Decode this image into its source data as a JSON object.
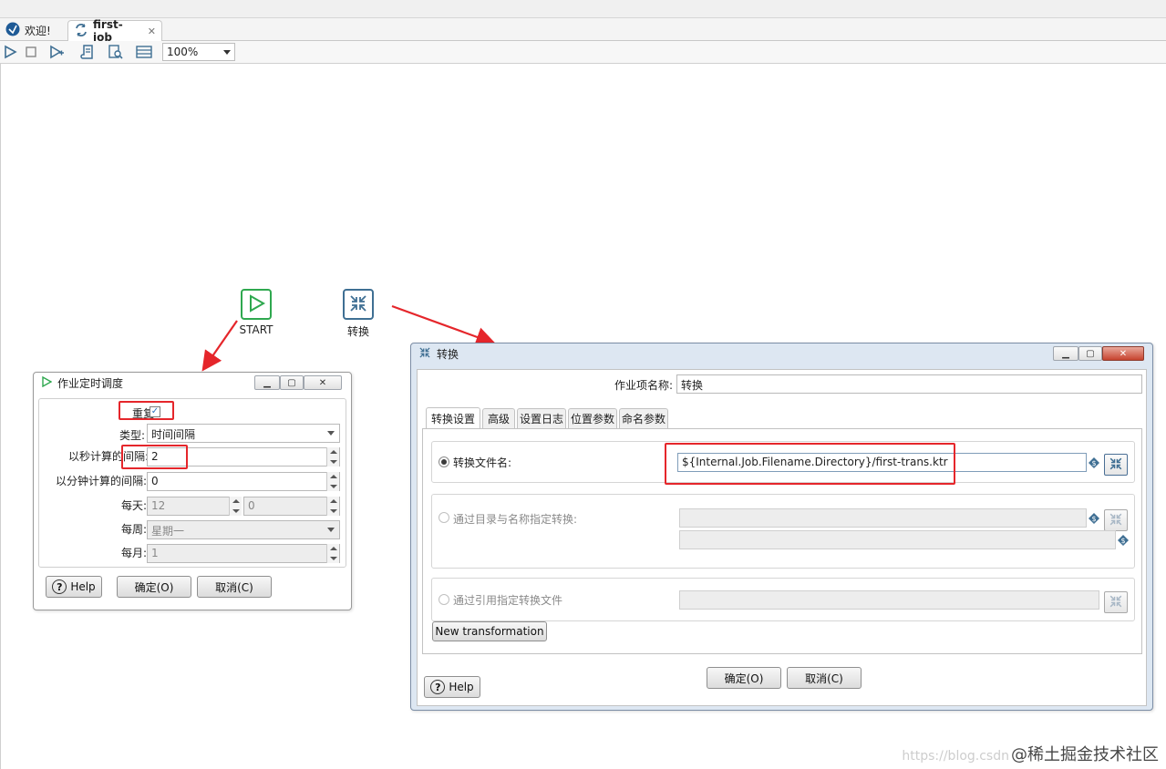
{
  "tabs": [
    {
      "label": "欢迎!",
      "icon": "spoon-icon"
    },
    {
      "label": "first-job",
      "icon": "job-icon",
      "close": "✕"
    }
  ],
  "toolbar": {
    "zoom": "100%"
  },
  "canvas": {
    "start_label": "START",
    "trans_label": "转换"
  },
  "schedule": {
    "title": "作业定时调度",
    "repeat_label": "重复:",
    "repeat_checked": true,
    "type_label": "类型:",
    "type_value": "时间间隔",
    "sec_label": "以秒计算的间隔:",
    "sec_value": "2",
    "min_label": "以分钟计算的间隔:",
    "min_value": "0",
    "daily_label": "每天:",
    "daily_hour": "12",
    "daily_minute": "0",
    "weekly_label": "每周:",
    "weekly_value": "星期一",
    "monthly_label": "每月:",
    "monthly_value": "1",
    "help": "Help",
    "ok": "确定(O)",
    "cancel": "取消(C)"
  },
  "trans": {
    "title": "转换",
    "name_label": "作业项名称:",
    "name_value": "转换",
    "tabs": [
      "转换设置",
      "高级",
      "设置日志",
      "位置参数",
      "命名参数"
    ],
    "file_label": "转换文件名:",
    "file_value": "${Internal.Job.Filename.Directory}/first-trans.ktr",
    "dir_label": "通过目录与名称指定转换:",
    "ref_label": "通过引用指定转换文件",
    "new_btn": "New transformation",
    "help": "Help",
    "ok": "确定(O)",
    "cancel": "取消(C)"
  },
  "watermark": {
    "url": "https://blog.csdn",
    "text": "@稀土掘金技术社区"
  },
  "colors": {
    "annotation_red": "#e5262b",
    "start_green": "#2fa84f",
    "trans_blue": "#3f6f93"
  }
}
